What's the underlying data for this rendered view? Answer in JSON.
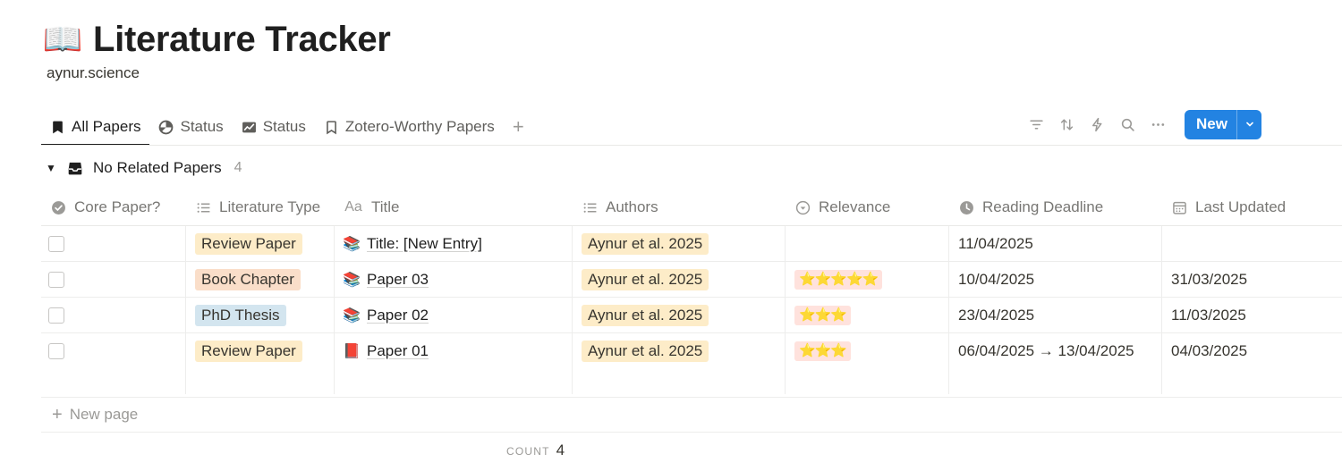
{
  "page": {
    "emoji": "📖",
    "title": "Literature Tracker",
    "subtitle": "aynur.science"
  },
  "tabs": [
    {
      "label": "All Papers",
      "icon": "bookmark-filled-icon",
      "active": true
    },
    {
      "label": "Status",
      "icon": "pie-chart-icon",
      "active": false
    },
    {
      "label": "Status",
      "icon": "line-chart-icon",
      "active": false
    },
    {
      "label": "Zotero-Worthy Papers",
      "icon": "bookmark-outline-icon",
      "active": false
    }
  ],
  "tab_add_label": "+",
  "toolbar": {
    "icons": [
      "filter-icon",
      "sort-icon",
      "automation-bolt-icon",
      "search-icon",
      "more-icon"
    ],
    "new_label": "New",
    "accent": "#2383e2"
  },
  "group": {
    "label": "No Related Papers",
    "count": "4"
  },
  "columns": [
    {
      "label": "Core Paper?",
      "icon": "checkbox-circle-icon"
    },
    {
      "label": "Literature Type",
      "icon": "list-icon"
    },
    {
      "label": "Title",
      "icon": "text-aa-icon"
    },
    {
      "label": "Authors",
      "icon": "list-icon"
    },
    {
      "label": "Relevance",
      "icon": "select-circle-icon"
    },
    {
      "label": "Reading Deadline",
      "icon": "clock-icon"
    },
    {
      "label": "Last Updated",
      "icon": "calendar-icon"
    }
  ],
  "rows": [
    {
      "core": false,
      "type": "Review Paper",
      "type_color": "#fdecc8",
      "emoji": "📚",
      "title": "Title: [New Entry]",
      "authors": "Aynur et al. 2025",
      "relevance": "",
      "deadline": "11/04/2025",
      "updated": ""
    },
    {
      "core": false,
      "type": "Book Chapter",
      "type_color": "#fadec9",
      "emoji": "📚",
      "title": "Paper 03",
      "authors": "Aynur et al. 2025",
      "relevance": "⭐⭐⭐⭐⭐",
      "deadline": "10/04/2025",
      "updated": "31/03/2025"
    },
    {
      "core": false,
      "type": "PhD Thesis",
      "type_color": "#d3e5ef",
      "emoji": "📚",
      "title": "Paper 02",
      "authors": "Aynur et al. 2025",
      "relevance": "⭐⭐⭐",
      "deadline": "23/04/2025",
      "updated": "11/03/2025"
    },
    {
      "core": false,
      "type": "Review Paper",
      "type_color": "#fdecc8",
      "emoji": "📕",
      "title": "Paper 01",
      "authors": "Aynur et al. 2025",
      "relevance": "⭐⭐⭐",
      "deadline": "06/04/2025 → 13/04/2025",
      "updated": "04/03/2025"
    }
  ],
  "new_page_label": "New page",
  "footer": {
    "count_label": "COUNT",
    "count_value": "4"
  }
}
